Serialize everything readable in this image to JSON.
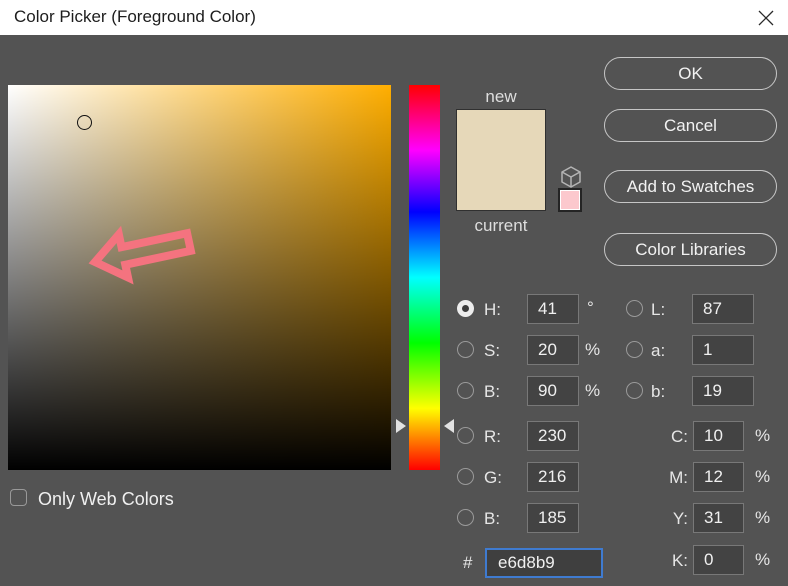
{
  "titlebar": {
    "title": "Color Picker (Foreground Color)"
  },
  "buttons": {
    "ok": "OK",
    "cancel": "Cancel",
    "add_to_swatches": "Add to Swatches",
    "color_libraries": "Color Libraries"
  },
  "preview": {
    "new_label": "new",
    "current_label": "current"
  },
  "fields": {
    "h": {
      "label": "H:",
      "value": "41",
      "unit": "°"
    },
    "s": {
      "label": "S:",
      "value": "20",
      "unit": "%"
    },
    "b_hsb": {
      "label": "B:",
      "value": "90",
      "unit": "%"
    },
    "l": {
      "label": "L:",
      "value": "87"
    },
    "a": {
      "label": "a:",
      "value": "1"
    },
    "b_lab": {
      "label": "b:",
      "value": "19"
    },
    "r": {
      "label": "R:",
      "value": "230"
    },
    "g": {
      "label": "G:",
      "value": "216"
    },
    "b_rgb": {
      "label": "B:",
      "value": "185"
    },
    "c": {
      "label": "C:",
      "value": "10",
      "unit": "%"
    },
    "m": {
      "label": "M:",
      "value": "12",
      "unit": "%"
    },
    "y": {
      "label": "Y:",
      "value": "31",
      "unit": "%"
    },
    "k": {
      "label": "K:",
      "value": "0",
      "unit": "%"
    },
    "hex": {
      "label": "#",
      "value": "e6d8b9"
    }
  },
  "checkbox": {
    "label": "Only Web Colors",
    "checked": false
  },
  "colors": {
    "dialog_bg": "#535353",
    "titlebar_bg": "#ffffff",
    "hue_base": "#ffae00",
    "swatch_new": "#e6d8b9",
    "swatch_current": "#e6d8b9",
    "web_safe": "#fcc8cd",
    "arrow": "#f4737f",
    "focus_border": "#3f7bd0"
  }
}
